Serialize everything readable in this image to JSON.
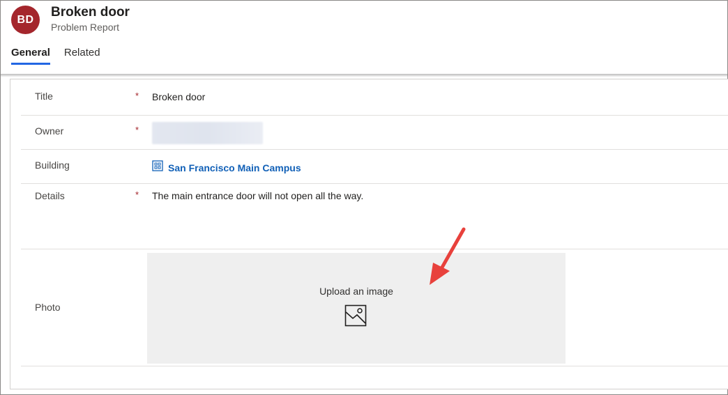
{
  "header": {
    "avatar_initials": "BD",
    "avatar_color": "#a4262c",
    "title": "Broken door",
    "entity_type": "Problem Report"
  },
  "tabs": [
    {
      "label": "General",
      "active": true
    },
    {
      "label": "Related",
      "active": false
    }
  ],
  "form": {
    "required_marker": "*",
    "fields": {
      "title": {
        "label": "Title",
        "required": true,
        "value": "Broken door"
      },
      "owner": {
        "label": "Owner",
        "required": true,
        "value_redacted": true
      },
      "building": {
        "label": "Building",
        "required": false,
        "value": "San Francisco Main Campus",
        "icon": "building-icon"
      },
      "details": {
        "label": "Details",
        "required": true,
        "value": "The main entrance door will not open all the way."
      },
      "photo": {
        "label": "Photo",
        "upload_text": "Upload an image",
        "icon": "image-icon"
      }
    }
  },
  "colors": {
    "accent": "#2266e3",
    "link": "#1160b7",
    "required": "#a4262c",
    "annotation_arrow": "#e8413c"
  }
}
